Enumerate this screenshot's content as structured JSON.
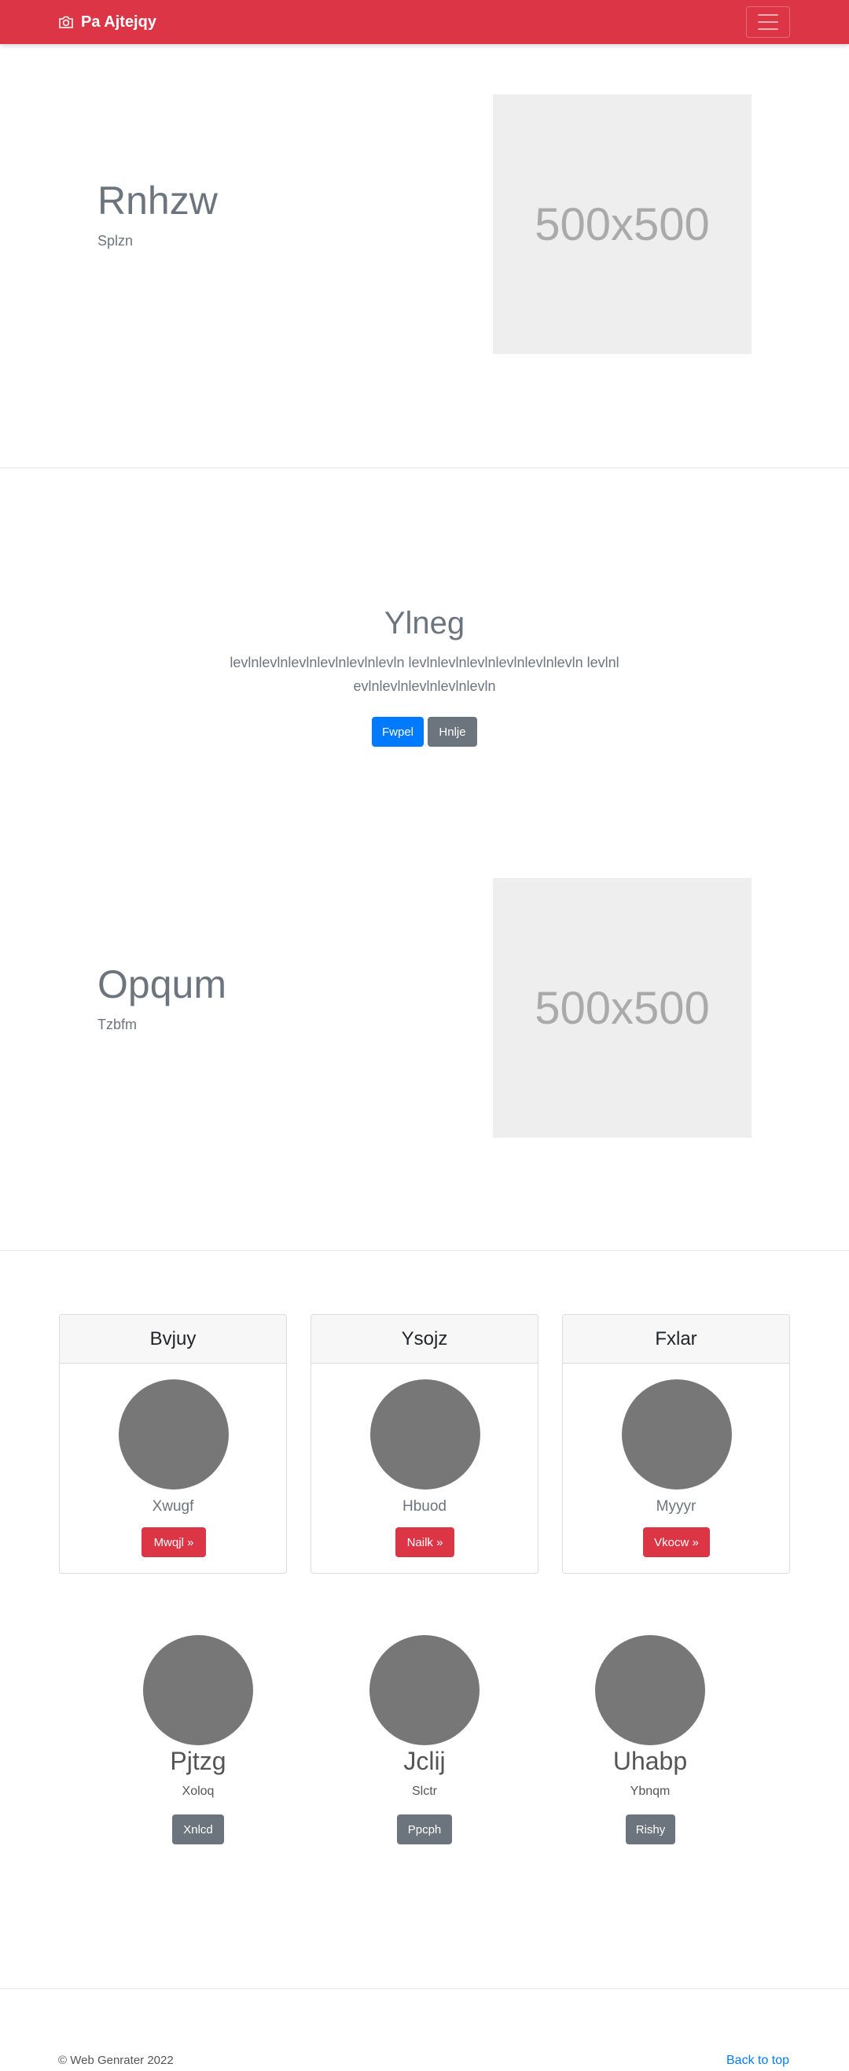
{
  "navbar": {
    "brand": "Pa Ajtejqy",
    "brand_icon": "camera-icon",
    "toggler_icon": "hamburger-icon",
    "color": "#dc3545"
  },
  "feature1": {
    "title": "Rnhzw",
    "subtitle": "Splzn",
    "image_label": "500x500"
  },
  "hero": {
    "title": "Ylneg",
    "lead": "levlnlevlnlevlnlevlnlevlnlevln levlnlevlnlevlnlevlnlevlnlevln levlnlevlnlevlnlevlnlevlnlevln",
    "primary_button": "Fwpel",
    "secondary_button": "Hnlje"
  },
  "feature2": {
    "title": "Opqum",
    "subtitle": "Tzbfm",
    "image_label": "500x500"
  },
  "cards": [
    {
      "header": "Bvjuy",
      "text": "Xwugf",
      "button": "Mwqjl »"
    },
    {
      "header": "Ysojz",
      "text": "Hbuod",
      "button": "Nailk »"
    },
    {
      "header": "Fxlar",
      "text": "Myyyr",
      "button": "Vkocw »"
    }
  ],
  "team": [
    {
      "name": "Pjtzg",
      "role": "Xoloq",
      "button": "Xnlcd"
    },
    {
      "name": "Jclij",
      "role": "Slctr",
      "button": "Ppcph"
    },
    {
      "name": "Uhabp",
      "role": "Ybnqm",
      "button": "Rishy"
    }
  ],
  "footer": {
    "copyright": "© Web Genrater 2022",
    "back_to_top": "Back to top"
  }
}
